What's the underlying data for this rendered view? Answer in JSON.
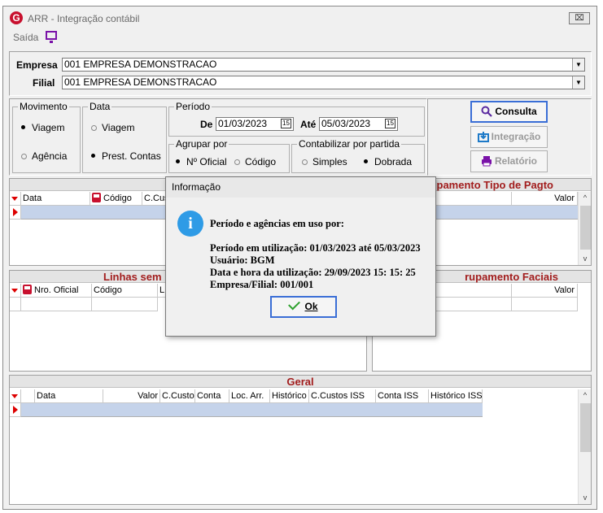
{
  "window": {
    "title": "ARR - Integração contábil",
    "close_label": "⌧"
  },
  "menu": {
    "saida": "Saída"
  },
  "empresa": {
    "label": "Empresa",
    "value": "001 EMPRESA DEMONSTRACAO"
  },
  "filial": {
    "label": "Filial",
    "value": "001 EMPRESA DEMONSTRACAO"
  },
  "movimento": {
    "title": "Movimento",
    "options": [
      "Viagem",
      "Agência"
    ],
    "selected": "Viagem"
  },
  "data_group": {
    "title": "Data",
    "options": [
      "Viagem",
      "Prest. Contas"
    ],
    "selected": "Prest. Contas"
  },
  "periodo": {
    "title": "Período",
    "de_label": "De",
    "de_value": "01/03/2023",
    "ate_label": "Até",
    "ate_value": "05/03/2023",
    "calendar_label": "15"
  },
  "agrupar": {
    "title": "Agrupar por",
    "options": [
      "Nº Oficial",
      "Código"
    ],
    "selected": "Nº Oficial"
  },
  "contabilizar": {
    "title": "Contabilizar por partida",
    "options": [
      "Simples",
      "Dobrada"
    ],
    "selected": "Dobrada"
  },
  "buttons": {
    "consulta": "Consulta",
    "integracao": "Integração",
    "relatorio": "Relatório"
  },
  "panel_top_left": {
    "columns": [
      "Data",
      "Código",
      "C.Cus"
    ]
  },
  "panel_top_right": {
    "title": "pamento Tipo de Pagto",
    "columns": [
      "Valor"
    ]
  },
  "panel_mid_left": {
    "title": "Linhas sem",
    "columns": [
      "Nro. Oficial",
      "Código",
      "L"
    ]
  },
  "panel_mid_right": {
    "title": "rupamento Faciais",
    "columns": [
      "Valor"
    ]
  },
  "panel_geral": {
    "title": "Geral",
    "columns": [
      "Data",
      "Valor",
      "C.Custo",
      "Conta",
      "Loc. Arr.",
      "Histórico",
      "C.Custos ISS",
      "Conta ISS",
      "Histórico ISS"
    ]
  },
  "dialog": {
    "title": "Informação",
    "heading": "Período e agências em uso por:",
    "lines": [
      "Período em utilização: 01/03/2023 até 05/03/2023",
      "Usuário: BGM",
      "Data e hora da utilização: 29/09/2023 15: 15: 25",
      "Empresa/Filial: 001/001"
    ],
    "ok_label": "Ok"
  },
  "colors": {
    "header_red": "#a21d1d",
    "selection": "#c5d3ea",
    "accent": "#3a6ed6",
    "brand": "#c8102e"
  }
}
